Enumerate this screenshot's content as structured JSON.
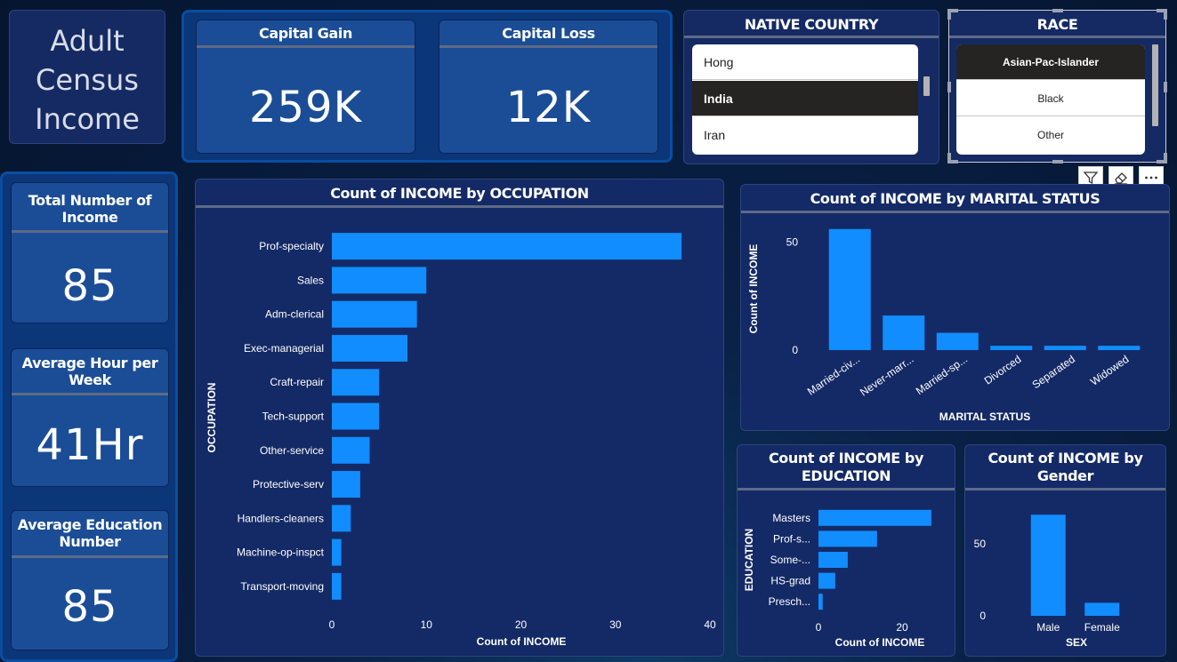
{
  "title_card": {
    "lines": [
      "Adult",
      "Census",
      "Income"
    ]
  },
  "kpi_top": [
    {
      "label": "Capital Gain",
      "value": "259K"
    },
    {
      "label": "Capital Loss",
      "value": "12K"
    }
  ],
  "kpi_left": [
    {
      "label_lines": [
        "Total Number of",
        "Income"
      ],
      "value": "85"
    },
    {
      "label_lines": [
        "Average Hour per",
        "Week"
      ],
      "value": "41Hr"
    },
    {
      "label_lines": [
        "Average Education",
        "Number"
      ],
      "value": "85"
    }
  ],
  "slicer_country": {
    "title": "NATIVE COUNTRY",
    "items": [
      {
        "label": "Hong",
        "selected": false
      },
      {
        "label": "India",
        "selected": true
      },
      {
        "label": "Iran",
        "selected": false
      }
    ]
  },
  "slicer_race": {
    "title": "RACE",
    "items": [
      {
        "label": "Asian-Pac-Islander",
        "selected": true
      },
      {
        "label": "Black",
        "selected": false
      },
      {
        "label": "Other",
        "selected": false
      }
    ]
  },
  "visual_header": {
    "icons": [
      "filter-icon",
      "eraser-icon",
      "more-options-icon"
    ]
  },
  "colors": {
    "bar": "#118dff",
    "panel": "#142a66",
    "accent": "#0b4da1"
  },
  "chart_data": [
    {
      "type": "bar",
      "orientation": "horizontal",
      "title": "Count of INCOME by OCCUPATION",
      "xlabel": "Count of INCOME",
      "ylabel": "OCCUPATION",
      "categories": [
        "Prof-specialty",
        "Sales",
        "Adm-clerical",
        "Exec-managerial",
        "Craft-repair",
        "Tech-support",
        "Other-service",
        "Protective-serv",
        "Handlers-cleaners",
        "Machine-op-inspct",
        "Transport-moving"
      ],
      "values": [
        37,
        10,
        9,
        8,
        5,
        5,
        4,
        3,
        2,
        1,
        1
      ],
      "xlim": [
        0,
        40
      ],
      "xticks": [
        0,
        10,
        20,
        30,
        40
      ]
    },
    {
      "type": "bar",
      "orientation": "vertical",
      "title": "Count of INCOME by MARITAL STATUS",
      "xlabel": "MARITAL STATUS",
      "ylabel": "Count of INCOME",
      "categories": [
        "Married-civ...",
        "Never-marr...",
        "Married-sp...",
        "Divorced",
        "Separated",
        "Widowed"
      ],
      "values": [
        56,
        16,
        8,
        2,
        2,
        2
      ],
      "ylim": [
        0,
        60
      ],
      "yticks": [
        0,
        50
      ]
    },
    {
      "type": "bar",
      "orientation": "horizontal",
      "title": "Count of INCOME by EDUCATION",
      "xlabel": "Count of INCOME",
      "ylabel": "EDUCATION",
      "categories": [
        "Masters",
        "Prof-s...",
        "Some-...",
        "HS-grad",
        "Presch..."
      ],
      "values": [
        27,
        14,
        7,
        4,
        1
      ],
      "xlim": [
        0,
        30
      ],
      "xticks": [
        0,
        20
      ]
    },
    {
      "type": "bar",
      "orientation": "vertical",
      "title": "Count of INCOME by Gender",
      "xlabel": "SEX",
      "ylabel": "",
      "categories": [
        "Male",
        "Female"
      ],
      "values": [
        70,
        9
      ],
      "ylim": [
        0,
        80
      ],
      "yticks": [
        0,
        50
      ]
    }
  ]
}
